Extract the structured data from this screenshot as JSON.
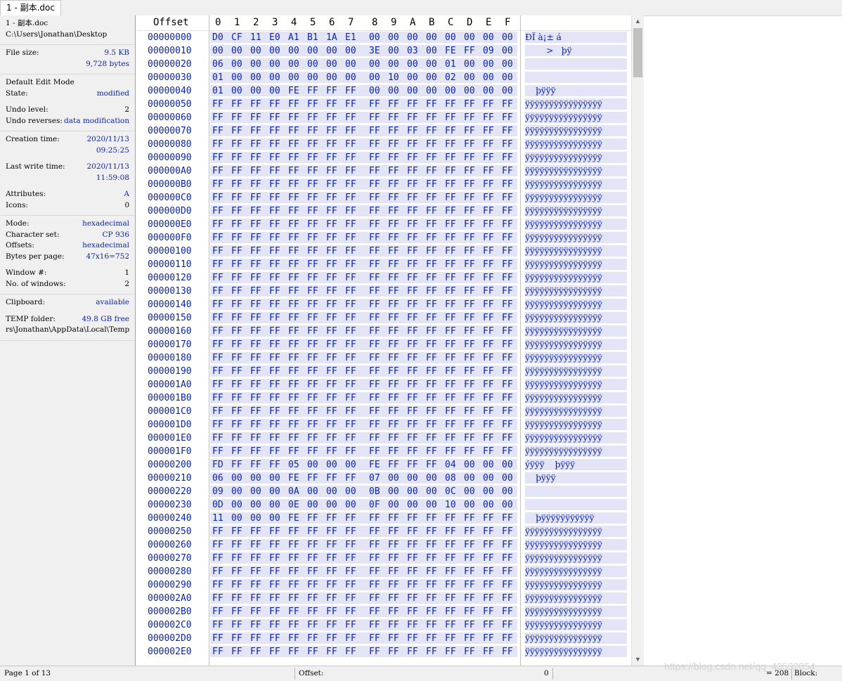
{
  "tab": {
    "label": "1 - 副本.doc"
  },
  "info": {
    "file_label": "1 - 副本.doc",
    "file_path": "C:\\Users\\Jonathan\\Desktop",
    "file_size_label": "File size:",
    "file_size_kb": "9.5 KB",
    "file_size_bytes": "9,728 bytes",
    "edit_mode_label": "Default Edit Mode",
    "state_label": "State:",
    "state_value": "modified",
    "undo_level_label": "Undo level:",
    "undo_level_value": "2",
    "undo_reverses_label": "Undo reverses:",
    "undo_reverses_value": "data modification",
    "creation_label": "Creation time:",
    "creation_date": "2020/11/13",
    "creation_time": "09:25:25",
    "lastwrite_label": "Last write time:",
    "lastwrite_date": "2020/11/13",
    "lastwrite_time": "11:59:08",
    "attributes_label": "Attributes:",
    "attributes_value": "A",
    "icons_label": "Icons:",
    "icons_value": "0",
    "mode_label": "Mode:",
    "mode_value": "hexadecimal",
    "charset_label": "Character set:",
    "charset_value": "CP 936",
    "offsets_label": "Offsets:",
    "offsets_value": "hexadecimal",
    "bpp_label": "Bytes per page:",
    "bpp_value": "47x16=752",
    "window_label": "Window #:",
    "window_value": "1",
    "nwin_label": "No. of windows:",
    "nwin_value": "2",
    "clipboard_label": "Clipboard:",
    "clipboard_value": "available",
    "temp_label": "TEMP folder:",
    "temp_value": "49.8 GB free",
    "temp_path": "rs\\Jonathan\\AppData\\Local\\Temp"
  },
  "header": {
    "offset_label": "Offset",
    "columns": [
      "0",
      "1",
      "2",
      "3",
      "4",
      "5",
      "6",
      "7",
      "8",
      "9",
      "A",
      "B",
      "C",
      "D",
      "E",
      "F"
    ]
  },
  "rows": [
    {
      "off": "00000000",
      "bytes": [
        "D0",
        "CF",
        "11",
        "E0",
        "A1",
        "B1",
        "1A",
        "E1",
        "00",
        "00",
        "00",
        "00",
        "00",
        "00",
        "00",
        "00"
      ],
      "text": "ÐÏ à¡± á"
    },
    {
      "off": "00000010",
      "bytes": [
        "00",
        "00",
        "00",
        "00",
        "00",
        "00",
        "00",
        "00",
        "3E",
        "00",
        "03",
        "00",
        "FE",
        "FF",
        "09",
        "00"
      ],
      "text": "        >   þÿ"
    },
    {
      "off": "00000020",
      "bytes": [
        "06",
        "00",
        "00",
        "00",
        "00",
        "00",
        "00",
        "00",
        "00",
        "00",
        "00",
        "00",
        "01",
        "00",
        "00",
        "00"
      ],
      "text": ""
    },
    {
      "off": "00000030",
      "bytes": [
        "01",
        "00",
        "00",
        "00",
        "00",
        "00",
        "00",
        "00",
        "00",
        "10",
        "00",
        "00",
        "02",
        "00",
        "00",
        "00"
      ],
      "text": ""
    },
    {
      "off": "00000040",
      "bytes": [
        "01",
        "00",
        "00",
        "00",
        "FE",
        "FF",
        "FF",
        "FF",
        "00",
        "00",
        "00",
        "00",
        "00",
        "00",
        "00",
        "00"
      ],
      "text": "    þÿÿÿ"
    },
    {
      "off": "00000050",
      "bytes": [
        "FF",
        "FF",
        "FF",
        "FF",
        "FF",
        "FF",
        "FF",
        "FF",
        "FF",
        "FF",
        "FF",
        "FF",
        "FF",
        "FF",
        "FF",
        "FF"
      ],
      "text": "ÿÿÿÿÿÿÿÿÿÿÿÿÿÿÿÿ"
    },
    {
      "off": "00000060",
      "bytes": [
        "FF",
        "FF",
        "FF",
        "FF",
        "FF",
        "FF",
        "FF",
        "FF",
        "FF",
        "FF",
        "FF",
        "FF",
        "FF",
        "FF",
        "FF",
        "FF"
      ],
      "text": "ÿÿÿÿÿÿÿÿÿÿÿÿÿÿÿÿ"
    },
    {
      "off": "00000070",
      "bytes": [
        "FF",
        "FF",
        "FF",
        "FF",
        "FF",
        "FF",
        "FF",
        "FF",
        "FF",
        "FF",
        "FF",
        "FF",
        "FF",
        "FF",
        "FF",
        "FF"
      ],
      "text": "ÿÿÿÿÿÿÿÿÿÿÿÿÿÿÿÿ"
    },
    {
      "off": "00000080",
      "bytes": [
        "FF",
        "FF",
        "FF",
        "FF",
        "FF",
        "FF",
        "FF",
        "FF",
        "FF",
        "FF",
        "FF",
        "FF",
        "FF",
        "FF",
        "FF",
        "FF"
      ],
      "text": "ÿÿÿÿÿÿÿÿÿÿÿÿÿÿÿÿ"
    },
    {
      "off": "00000090",
      "bytes": [
        "FF",
        "FF",
        "FF",
        "FF",
        "FF",
        "FF",
        "FF",
        "FF",
        "FF",
        "FF",
        "FF",
        "FF",
        "FF",
        "FF",
        "FF",
        "FF"
      ],
      "text": "ÿÿÿÿÿÿÿÿÿÿÿÿÿÿÿÿ"
    },
    {
      "off": "000000A0",
      "bytes": [
        "FF",
        "FF",
        "FF",
        "FF",
        "FF",
        "FF",
        "FF",
        "FF",
        "FF",
        "FF",
        "FF",
        "FF",
        "FF",
        "FF",
        "FF",
        "FF"
      ],
      "text": "ÿÿÿÿÿÿÿÿÿÿÿÿÿÿÿÿ"
    },
    {
      "off": "000000B0",
      "bytes": [
        "FF",
        "FF",
        "FF",
        "FF",
        "FF",
        "FF",
        "FF",
        "FF",
        "FF",
        "FF",
        "FF",
        "FF",
        "FF",
        "FF",
        "FF",
        "FF"
      ],
      "text": "ÿÿÿÿÿÿÿÿÿÿÿÿÿÿÿÿ"
    },
    {
      "off": "000000C0",
      "bytes": [
        "FF",
        "FF",
        "FF",
        "FF",
        "FF",
        "FF",
        "FF",
        "FF",
        "FF",
        "FF",
        "FF",
        "FF",
        "FF",
        "FF",
        "FF",
        "FF"
      ],
      "text": "ÿÿÿÿÿÿÿÿÿÿÿÿÿÿÿÿ"
    },
    {
      "off": "000000D0",
      "bytes": [
        "FF",
        "FF",
        "FF",
        "FF",
        "FF",
        "FF",
        "FF",
        "FF",
        "FF",
        "FF",
        "FF",
        "FF",
        "FF",
        "FF",
        "FF",
        "FF"
      ],
      "text": "ÿÿÿÿÿÿÿÿÿÿÿÿÿÿÿÿ"
    },
    {
      "off": "000000E0",
      "bytes": [
        "FF",
        "FF",
        "FF",
        "FF",
        "FF",
        "FF",
        "FF",
        "FF",
        "FF",
        "FF",
        "FF",
        "FF",
        "FF",
        "FF",
        "FF",
        "FF"
      ],
      "text": "ÿÿÿÿÿÿÿÿÿÿÿÿÿÿÿÿ"
    },
    {
      "off": "000000F0",
      "bytes": [
        "FF",
        "FF",
        "FF",
        "FF",
        "FF",
        "FF",
        "FF",
        "FF",
        "FF",
        "FF",
        "FF",
        "FF",
        "FF",
        "FF",
        "FF",
        "FF"
      ],
      "text": "ÿÿÿÿÿÿÿÿÿÿÿÿÿÿÿÿ"
    },
    {
      "off": "00000100",
      "bytes": [
        "FF",
        "FF",
        "FF",
        "FF",
        "FF",
        "FF",
        "FF",
        "FF",
        "FF",
        "FF",
        "FF",
        "FF",
        "FF",
        "FF",
        "FF",
        "FF"
      ],
      "text": "ÿÿÿÿÿÿÿÿÿÿÿÿÿÿÿÿ"
    },
    {
      "off": "00000110",
      "bytes": [
        "FF",
        "FF",
        "FF",
        "FF",
        "FF",
        "FF",
        "FF",
        "FF",
        "FF",
        "FF",
        "FF",
        "FF",
        "FF",
        "FF",
        "FF",
        "FF"
      ],
      "text": "ÿÿÿÿÿÿÿÿÿÿÿÿÿÿÿÿ"
    },
    {
      "off": "00000120",
      "bytes": [
        "FF",
        "FF",
        "FF",
        "FF",
        "FF",
        "FF",
        "FF",
        "FF",
        "FF",
        "FF",
        "FF",
        "FF",
        "FF",
        "FF",
        "FF",
        "FF"
      ],
      "text": "ÿÿÿÿÿÿÿÿÿÿÿÿÿÿÿÿ"
    },
    {
      "off": "00000130",
      "bytes": [
        "FF",
        "FF",
        "FF",
        "FF",
        "FF",
        "FF",
        "FF",
        "FF",
        "FF",
        "FF",
        "FF",
        "FF",
        "FF",
        "FF",
        "FF",
        "FF"
      ],
      "text": "ÿÿÿÿÿÿÿÿÿÿÿÿÿÿÿÿ"
    },
    {
      "off": "00000140",
      "bytes": [
        "FF",
        "FF",
        "FF",
        "FF",
        "FF",
        "FF",
        "FF",
        "FF",
        "FF",
        "FF",
        "FF",
        "FF",
        "FF",
        "FF",
        "FF",
        "FF"
      ],
      "text": "ÿÿÿÿÿÿÿÿÿÿÿÿÿÿÿÿ"
    },
    {
      "off": "00000150",
      "bytes": [
        "FF",
        "FF",
        "FF",
        "FF",
        "FF",
        "FF",
        "FF",
        "FF",
        "FF",
        "FF",
        "FF",
        "FF",
        "FF",
        "FF",
        "FF",
        "FF"
      ],
      "text": "ÿÿÿÿÿÿÿÿÿÿÿÿÿÿÿÿ"
    },
    {
      "off": "00000160",
      "bytes": [
        "FF",
        "FF",
        "FF",
        "FF",
        "FF",
        "FF",
        "FF",
        "FF",
        "FF",
        "FF",
        "FF",
        "FF",
        "FF",
        "FF",
        "FF",
        "FF"
      ],
      "text": "ÿÿÿÿÿÿÿÿÿÿÿÿÿÿÿÿ"
    },
    {
      "off": "00000170",
      "bytes": [
        "FF",
        "FF",
        "FF",
        "FF",
        "FF",
        "FF",
        "FF",
        "FF",
        "FF",
        "FF",
        "FF",
        "FF",
        "FF",
        "FF",
        "FF",
        "FF"
      ],
      "text": "ÿÿÿÿÿÿÿÿÿÿÿÿÿÿÿÿ"
    },
    {
      "off": "00000180",
      "bytes": [
        "FF",
        "FF",
        "FF",
        "FF",
        "FF",
        "FF",
        "FF",
        "FF",
        "FF",
        "FF",
        "FF",
        "FF",
        "FF",
        "FF",
        "FF",
        "FF"
      ],
      "text": "ÿÿÿÿÿÿÿÿÿÿÿÿÿÿÿÿ"
    },
    {
      "off": "00000190",
      "bytes": [
        "FF",
        "FF",
        "FF",
        "FF",
        "FF",
        "FF",
        "FF",
        "FF",
        "FF",
        "FF",
        "FF",
        "FF",
        "FF",
        "FF",
        "FF",
        "FF"
      ],
      "text": "ÿÿÿÿÿÿÿÿÿÿÿÿÿÿÿÿ"
    },
    {
      "off": "000001A0",
      "bytes": [
        "FF",
        "FF",
        "FF",
        "FF",
        "FF",
        "FF",
        "FF",
        "FF",
        "FF",
        "FF",
        "FF",
        "FF",
        "FF",
        "FF",
        "FF",
        "FF"
      ],
      "text": "ÿÿÿÿÿÿÿÿÿÿÿÿÿÿÿÿ"
    },
    {
      "off": "000001B0",
      "bytes": [
        "FF",
        "FF",
        "FF",
        "FF",
        "FF",
        "FF",
        "FF",
        "FF",
        "FF",
        "FF",
        "FF",
        "FF",
        "FF",
        "FF",
        "FF",
        "FF"
      ],
      "text": "ÿÿÿÿÿÿÿÿÿÿÿÿÿÿÿÿ"
    },
    {
      "off": "000001C0",
      "bytes": [
        "FF",
        "FF",
        "FF",
        "FF",
        "FF",
        "FF",
        "FF",
        "FF",
        "FF",
        "FF",
        "FF",
        "FF",
        "FF",
        "FF",
        "FF",
        "FF"
      ],
      "text": "ÿÿÿÿÿÿÿÿÿÿÿÿÿÿÿÿ"
    },
    {
      "off": "000001D0",
      "bytes": [
        "FF",
        "FF",
        "FF",
        "FF",
        "FF",
        "FF",
        "FF",
        "FF",
        "FF",
        "FF",
        "FF",
        "FF",
        "FF",
        "FF",
        "FF",
        "FF"
      ],
      "text": "ÿÿÿÿÿÿÿÿÿÿÿÿÿÿÿÿ"
    },
    {
      "off": "000001E0",
      "bytes": [
        "FF",
        "FF",
        "FF",
        "FF",
        "FF",
        "FF",
        "FF",
        "FF",
        "FF",
        "FF",
        "FF",
        "FF",
        "FF",
        "FF",
        "FF",
        "FF"
      ],
      "text": "ÿÿÿÿÿÿÿÿÿÿÿÿÿÿÿÿ"
    },
    {
      "off": "000001F0",
      "bytes": [
        "FF",
        "FF",
        "FF",
        "FF",
        "FF",
        "FF",
        "FF",
        "FF",
        "FF",
        "FF",
        "FF",
        "FF",
        "FF",
        "FF",
        "FF",
        "FF"
      ],
      "text": "ÿÿÿÿÿÿÿÿÿÿÿÿÿÿÿÿ"
    },
    {
      "off": "00000200",
      "bytes": [
        "FD",
        "FF",
        "FF",
        "FF",
        "05",
        "00",
        "00",
        "00",
        "FE",
        "FF",
        "FF",
        "FF",
        "04",
        "00",
        "00",
        "00"
      ],
      "text": "ýÿÿÿ    þÿÿÿ"
    },
    {
      "off": "00000210",
      "bytes": [
        "06",
        "00",
        "00",
        "00",
        "FE",
        "FF",
        "FF",
        "FF",
        "07",
        "00",
        "00",
        "00",
        "08",
        "00",
        "00",
        "00"
      ],
      "text": "    þÿÿÿ"
    },
    {
      "off": "00000220",
      "bytes": [
        "09",
        "00",
        "00",
        "00",
        "0A",
        "00",
        "00",
        "00",
        "0B",
        "00",
        "00",
        "00",
        "0C",
        "00",
        "00",
        "00"
      ],
      "text": ""
    },
    {
      "off": "00000230",
      "bytes": [
        "0D",
        "00",
        "00",
        "00",
        "0E",
        "00",
        "00",
        "00",
        "0F",
        "00",
        "00",
        "00",
        "10",
        "00",
        "00",
        "00"
      ],
      "text": ""
    },
    {
      "off": "00000240",
      "bytes": [
        "11",
        "00",
        "00",
        "00",
        "FE",
        "FF",
        "FF",
        "FF",
        "FF",
        "FF",
        "FF",
        "FF",
        "FF",
        "FF",
        "FF",
        "FF"
      ],
      "text": "    þÿÿÿÿÿÿÿÿÿÿÿ"
    },
    {
      "off": "00000250",
      "bytes": [
        "FF",
        "FF",
        "FF",
        "FF",
        "FF",
        "FF",
        "FF",
        "FF",
        "FF",
        "FF",
        "FF",
        "FF",
        "FF",
        "FF",
        "FF",
        "FF"
      ],
      "text": "ÿÿÿÿÿÿÿÿÿÿÿÿÿÿÿÿ"
    },
    {
      "off": "00000260",
      "bytes": [
        "FF",
        "FF",
        "FF",
        "FF",
        "FF",
        "FF",
        "FF",
        "FF",
        "FF",
        "FF",
        "FF",
        "FF",
        "FF",
        "FF",
        "FF",
        "FF"
      ],
      "text": "ÿÿÿÿÿÿÿÿÿÿÿÿÿÿÿÿ"
    },
    {
      "off": "00000270",
      "bytes": [
        "FF",
        "FF",
        "FF",
        "FF",
        "FF",
        "FF",
        "FF",
        "FF",
        "FF",
        "FF",
        "FF",
        "FF",
        "FF",
        "FF",
        "FF",
        "FF"
      ],
      "text": "ÿÿÿÿÿÿÿÿÿÿÿÿÿÿÿÿ"
    },
    {
      "off": "00000280",
      "bytes": [
        "FF",
        "FF",
        "FF",
        "FF",
        "FF",
        "FF",
        "FF",
        "FF",
        "FF",
        "FF",
        "FF",
        "FF",
        "FF",
        "FF",
        "FF",
        "FF"
      ],
      "text": "ÿÿÿÿÿÿÿÿÿÿÿÿÿÿÿÿ"
    },
    {
      "off": "00000290",
      "bytes": [
        "FF",
        "FF",
        "FF",
        "FF",
        "FF",
        "FF",
        "FF",
        "FF",
        "FF",
        "FF",
        "FF",
        "FF",
        "FF",
        "FF",
        "FF",
        "FF"
      ],
      "text": "ÿÿÿÿÿÿÿÿÿÿÿÿÿÿÿÿ"
    },
    {
      "off": "000002A0",
      "bytes": [
        "FF",
        "FF",
        "FF",
        "FF",
        "FF",
        "FF",
        "FF",
        "FF",
        "FF",
        "FF",
        "FF",
        "FF",
        "FF",
        "FF",
        "FF",
        "FF"
      ],
      "text": "ÿÿÿÿÿÿÿÿÿÿÿÿÿÿÿÿ"
    },
    {
      "off": "000002B0",
      "bytes": [
        "FF",
        "FF",
        "FF",
        "FF",
        "FF",
        "FF",
        "FF",
        "FF",
        "FF",
        "FF",
        "FF",
        "FF",
        "FF",
        "FF",
        "FF",
        "FF"
      ],
      "text": "ÿÿÿÿÿÿÿÿÿÿÿÿÿÿÿÿ"
    },
    {
      "off": "000002C0",
      "bytes": [
        "FF",
        "FF",
        "FF",
        "FF",
        "FF",
        "FF",
        "FF",
        "FF",
        "FF",
        "FF",
        "FF",
        "FF",
        "FF",
        "FF",
        "FF",
        "FF"
      ],
      "text": "ÿÿÿÿÿÿÿÿÿÿÿÿÿÿÿÿ"
    },
    {
      "off": "000002D0",
      "bytes": [
        "FF",
        "FF",
        "FF",
        "FF",
        "FF",
        "FF",
        "FF",
        "FF",
        "FF",
        "FF",
        "FF",
        "FF",
        "FF",
        "FF",
        "FF",
        "FF"
      ],
      "text": "ÿÿÿÿÿÿÿÿÿÿÿÿÿÿÿÿ"
    },
    {
      "off": "000002E0",
      "bytes": [
        "FF",
        "FF",
        "FF",
        "FF",
        "FF",
        "FF",
        "FF",
        "FF",
        "FF",
        "FF",
        "FF",
        "FF",
        "FF",
        "FF",
        "FF",
        "FF"
      ],
      "text": "ÿÿÿÿÿÿÿÿÿÿÿÿÿÿÿÿ"
    }
  ],
  "status": {
    "page": "Page 1 of 13",
    "offset_label": "Offset:",
    "offset_value": "0",
    "selection": "= 208",
    "block_label": "Block:"
  },
  "watermark": "https://blog.csdn.net/qq_43532054",
  "colors": {
    "hex_text": "#0b24a8",
    "row_bg": "#e4e4f7",
    "panel_bg": "#f0f0f0"
  }
}
